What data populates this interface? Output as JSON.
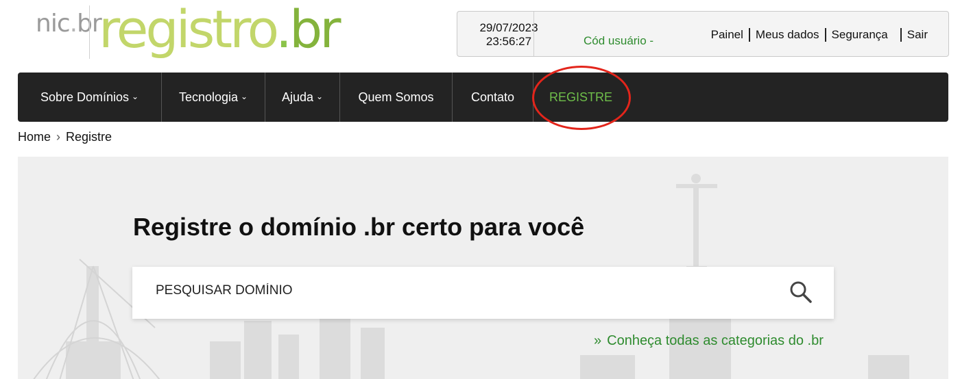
{
  "logo": {
    "nic": "nic",
    "nic_dot": ".",
    "nic_br": "br",
    "reg": "registro",
    "reg_dot": ".",
    "reg_br": "br"
  },
  "userbox": {
    "date": "29/07/2023",
    "time": "23:56:27",
    "cod_usuario": "Cód usuário -",
    "links": [
      "Painel",
      "Meus dados",
      "Segurança",
      "Sair"
    ]
  },
  "nav": {
    "items": [
      {
        "label": "Sobre Domínios",
        "dropdown": true
      },
      {
        "label": "Tecnologia",
        "dropdown": true
      },
      {
        "label": "Ajuda",
        "dropdown": true
      },
      {
        "label": "Quem Somos",
        "dropdown": false
      },
      {
        "label": "Contato",
        "dropdown": false
      },
      {
        "label": "REGISTRE",
        "dropdown": false,
        "active": true
      }
    ],
    "chevron": "⌄"
  },
  "breadcrumb": {
    "home": "Home",
    "separator": "›",
    "current": "Registre"
  },
  "hero": {
    "title": "Registre o domínio .br certo para você",
    "search_placeholder": "PESQUISAR DOMÍNIO",
    "search_icon": "search-icon",
    "categories_arrow": "»",
    "categories_link": "Conheça todas as categorias do .br"
  },
  "colors": {
    "brand_green": "#c2d66a",
    "link_green": "#2e8b2e",
    "nav_bg": "#232323",
    "registre_green": "#6fbf4a",
    "highlight_red": "#e3251b"
  }
}
